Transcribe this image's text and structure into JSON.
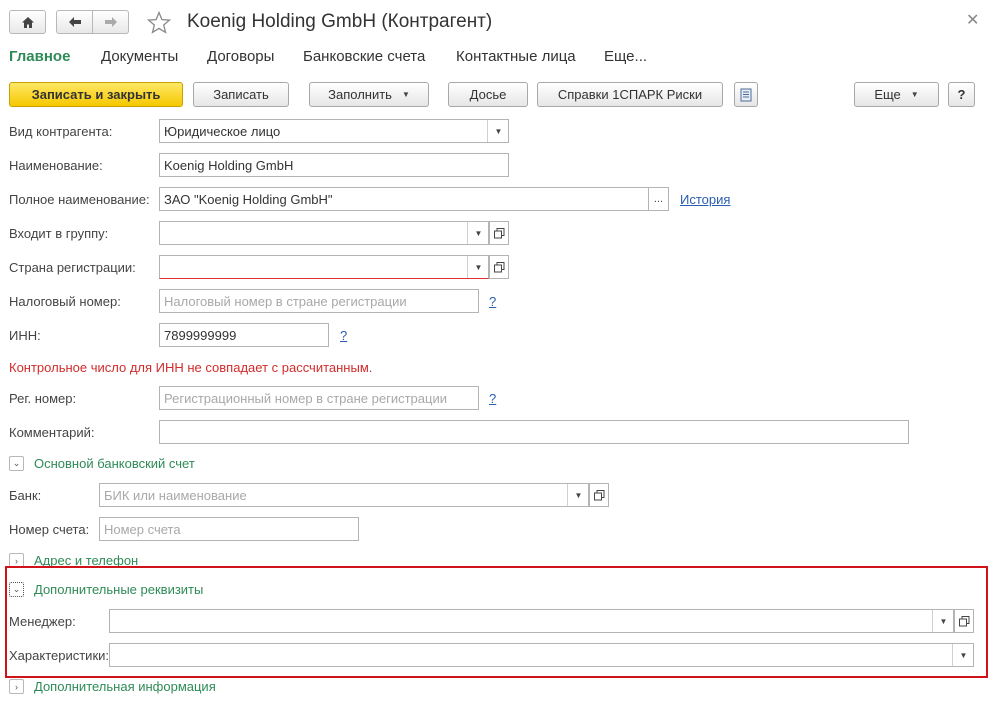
{
  "window": {
    "title": "Koenig Holding GmbH (Контрагент)",
    "icons": [
      "home-icon",
      "arrow-left-icon",
      "arrow-right-icon",
      "star-icon",
      "close-icon"
    ]
  },
  "tabs": [
    {
      "label": "Главное",
      "active": true
    },
    {
      "label": "Документы"
    },
    {
      "label": "Договоры"
    },
    {
      "label": "Банковские счета"
    },
    {
      "label": "Контактные лица"
    },
    {
      "label": "Еще..."
    }
  ],
  "toolbar": {
    "save_close": "Записать и закрыть",
    "save": "Записать",
    "fill": "Заполнить",
    "dossier": "Досье",
    "spark": "Справки 1СПАРК Риски",
    "more": "Еще",
    "help": "?"
  },
  "form": {
    "kind": {
      "label": "Вид контрагента:",
      "value": "Юридическое лицо"
    },
    "name": {
      "label": "Наименование:",
      "value": "Koenig Holding GmbH"
    },
    "full_name": {
      "label": "Полное наименование:",
      "value": "ЗАО \"Koenig Holding GmbH\"",
      "history_link": "История"
    },
    "group": {
      "label": "Входит в группу:",
      "value": ""
    },
    "country": {
      "label": "Страна регистрации:",
      "value": ""
    },
    "tax_number": {
      "label": "Налоговый номер:",
      "placeholder": "Налоговый номер в стране регистрации",
      "help": "?"
    },
    "inn": {
      "label": "ИНН:",
      "value": "7899999999",
      "help": "?"
    },
    "inn_error": "Контрольное число для ИНН не совпадает с рассчитанным.",
    "reg_number": {
      "label": "Рег. номер:",
      "placeholder": "Регистрационный номер в стране регистрации",
      "help": "?"
    },
    "comment": {
      "label": "Комментарий:",
      "value": ""
    }
  },
  "groups": {
    "bank": {
      "title": "Основной банковский счет",
      "bank_label": "Банк:",
      "bank_placeholder": "БИК или наименование",
      "account_label": "Номер счета:",
      "account_placeholder": "Номер счета"
    },
    "address": {
      "title": "Адрес и телефон"
    },
    "extra": {
      "title": "Дополнительные реквизиты",
      "manager_label": "Менеджер:",
      "manager_value": "",
      "characteristics_label": "Характеристики:",
      "characteristics_value": ""
    },
    "info": {
      "title": "Дополнительная информация"
    }
  },
  "colors": {
    "accent_green": "#2e8b57",
    "primary_yellow": "#f5c800",
    "error_red": "#d22c2c",
    "highlight_red": "#d0121b",
    "link_blue": "#2a5db0"
  }
}
